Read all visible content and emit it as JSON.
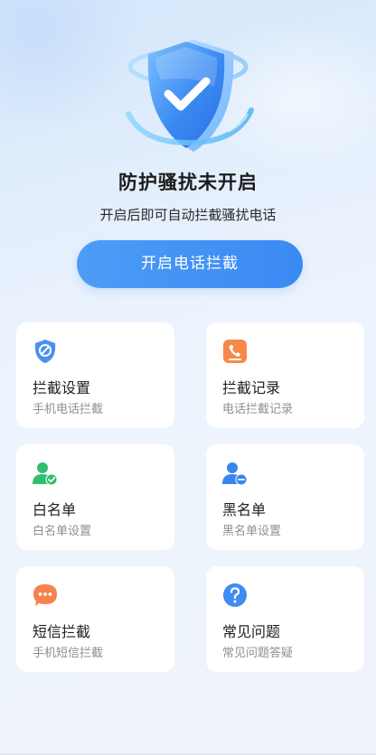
{
  "status": {
    "title": "防护骚扰未开启",
    "subtitle": "开启后即可自动拦截骚扰电话"
  },
  "actions": {
    "enable_label": "开启电话拦截"
  },
  "cards": [
    {
      "title": "拦截设置",
      "subtitle": "手机电话拦截",
      "icon": "block-shield-icon",
      "color": "#4a90f0"
    },
    {
      "title": "拦截记录",
      "subtitle": "电话拦截记录",
      "icon": "phone-record-icon",
      "color": "#f5894a"
    },
    {
      "title": "白名单",
      "subtitle": "白名单设置",
      "icon": "user-check-icon",
      "color": "#2fbf71"
    },
    {
      "title": "黑名单",
      "subtitle": "黑名单设置",
      "icon": "user-minus-icon",
      "color": "#3a86ee"
    },
    {
      "title": "短信拦截",
      "subtitle": "手机短信拦截",
      "icon": "message-dots-icon",
      "color": "#f7824d"
    },
    {
      "title": "常见问题",
      "subtitle": "常见问题答疑",
      "icon": "question-icon",
      "color": "#3f8cf2"
    }
  ]
}
